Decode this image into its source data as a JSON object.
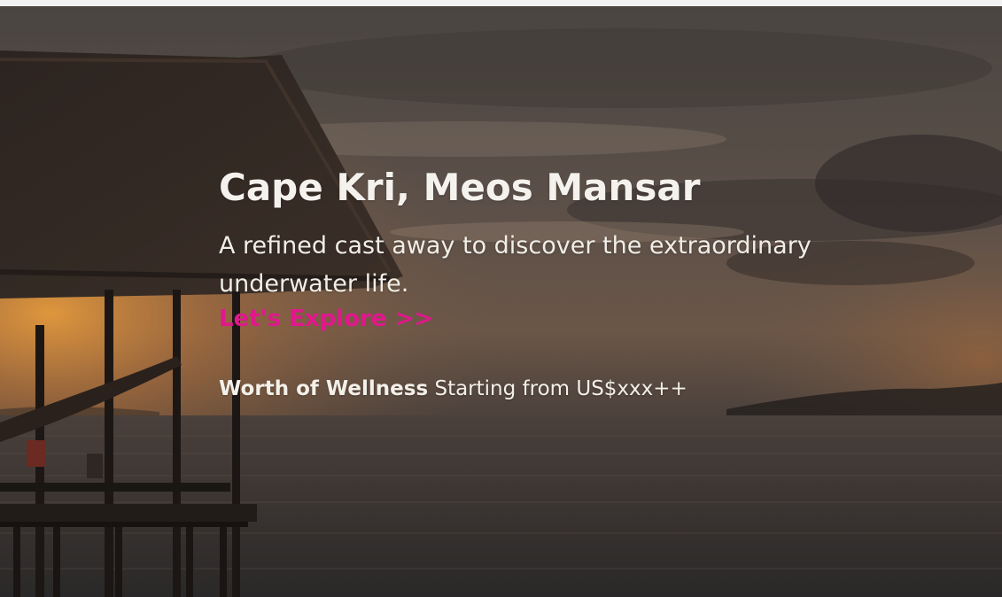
{
  "hero": {
    "title": "Cape Kri, Meos Mansar",
    "subtitle": "A refined cast away to discover the extraordinary underwater life.",
    "cta_label": "Let's Explore >>",
    "price_label": "Worth of Wellness",
    "price_text": " Starting from US$xxx++",
    "background_image": "sunset-beach-hut-photo"
  },
  "colors": {
    "cta": "#e0188c",
    "text": "#f3efe9"
  }
}
